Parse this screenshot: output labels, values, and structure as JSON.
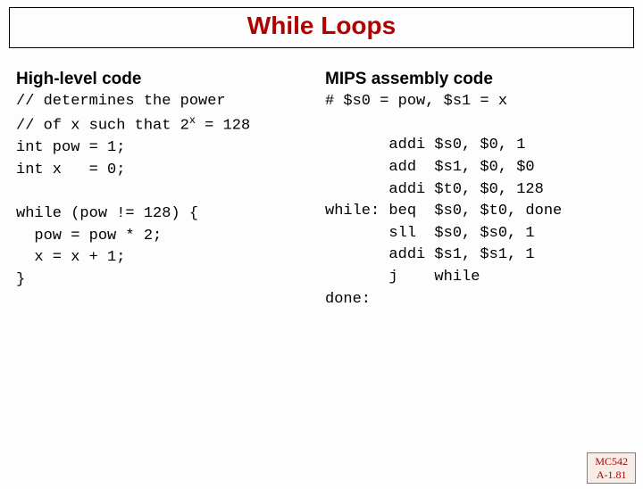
{
  "title": "While Loops",
  "left": {
    "heading": "High-level code",
    "lines": [
      "// determines the power",
      "// of x such that 2",
      "int pow = 1;",
      "int x   = 0;",
      "",
      "while (pow != 128) {",
      "  pow = pow * 2;",
      "  x = x + 1;",
      "}"
    ],
    "exp": "x",
    "eq128": " = 128"
  },
  "right": {
    "heading": "MIPS assembly code",
    "lines": [
      "# $s0 = pow, $s1 = x",
      "",
      "       addi $s0, $0, 1",
      "       add  $s1, $0, $0",
      "       addi $t0, $0, 128",
      "while: beq  $s0, $t0, done",
      "       sll  $s0, $s0, 1",
      "       addi $s1, $s1, 1",
      "       j    while",
      "done:"
    ]
  },
  "footer": {
    "course": "MC542",
    "page": "A-1.81"
  }
}
